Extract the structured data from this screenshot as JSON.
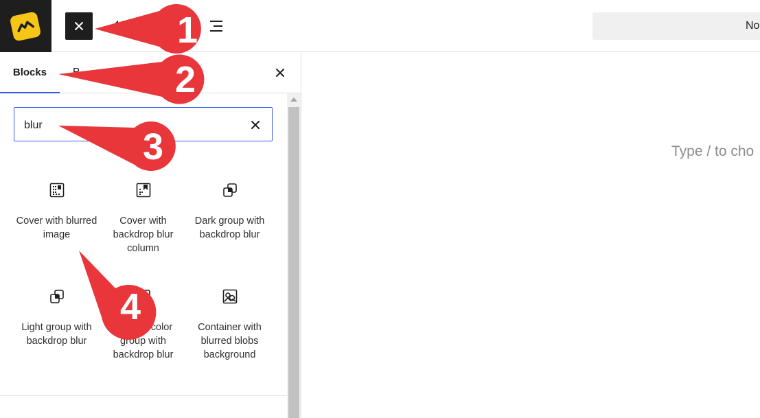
{
  "header": {
    "logo_icon": "logo-icon",
    "close_icon": "close-icon",
    "undo_icon": "undo-icon",
    "list_view_icon": "list-view-icon",
    "doc_title_partial": "No"
  },
  "sidebar": {
    "tabs": [
      {
        "label": "Blocks",
        "active": true
      },
      {
        "label": "Patterns",
        "visible_text": "P",
        "active": false
      }
    ],
    "search": {
      "value": "blur"
    },
    "blocks": [
      {
        "label": "Cover with blurred image",
        "icon": "cover-icon"
      },
      {
        "label": "Cover with backdrop blur column",
        "icon": "cover-icon"
      },
      {
        "label": "Dark group with backdrop blur",
        "icon": "group-icon"
      },
      {
        "label": "Light group with backdrop blur",
        "icon": "group-icon"
      },
      {
        "label": "Primary color group with backdrop blur",
        "icon": "group-icon"
      },
      {
        "label": "Container with blurred blobs background",
        "icon": "image-icon"
      }
    ]
  },
  "canvas": {
    "placeholder": "Type / to cho"
  },
  "callouts": [
    {
      "number": "1"
    },
    {
      "number": "2"
    },
    {
      "number": "3"
    },
    {
      "number": "4"
    }
  ],
  "colors": {
    "accent": "#3858e9",
    "callout": "#e8363b",
    "logo_bg": "#1e1e1e",
    "logo_mark": "#f5c518"
  }
}
